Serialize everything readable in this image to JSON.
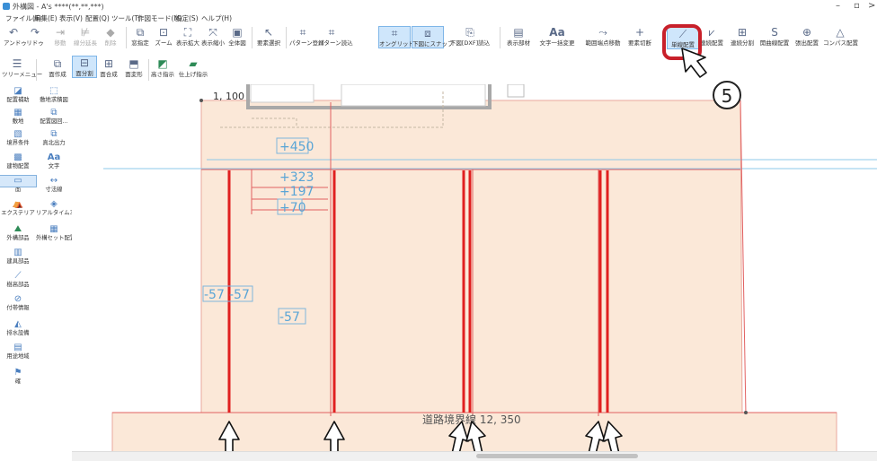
{
  "window": {
    "title": "外構図 - A's ****(**,**,***)",
    "minimize": "–",
    "restore": "▫",
    "more": ">"
  },
  "menu": [
    "ファイル(F)",
    "編集(E)",
    "表示(V)",
    "配置(Q)",
    "ツール(T)",
    "作図モード(M)",
    "設定(S)",
    "ヘルプ(H)"
  ],
  "toolbar_row1": [
    {
      "label": "アンドゥ",
      "icon": "undo-icon"
    },
    {
      "label": "リドゥ",
      "icon": "redo-icon"
    },
    {
      "label": "移動",
      "icon": "move-icon",
      "dim": true
    },
    {
      "label": "線分延長",
      "icon": "extend-icon",
      "dim": true
    },
    {
      "label": "削除",
      "icon": "delete-icon",
      "dim": true
    },
    {
      "label": "窓指定",
      "icon": "window-select-icon"
    },
    {
      "label": "ズーム",
      "icon": "zoom-icon"
    },
    {
      "label": "表示拡大",
      "icon": "zoom-in-icon"
    },
    {
      "label": "表示縮小",
      "icon": "zoom-out-icon"
    },
    {
      "label": "全体図",
      "icon": "fit-all-icon"
    },
    {
      "label": "要素選択",
      "icon": "select-arrow-icon"
    },
    {
      "label": "パターン登録",
      "icon": "pattern-register-icon"
    },
    {
      "label": "パターン読込",
      "icon": "pattern-load-icon"
    },
    {
      "label": "オングリッド",
      "icon": "on-grid-icon",
      "active": true
    },
    {
      "label": "下図にスナップ",
      "icon": "snap-underlay-icon",
      "active": true
    },
    {
      "label": "下図[DXF]読込",
      "icon": "dxf-import-icon"
    },
    {
      "label": "表示部材",
      "icon": "display-parts-icon"
    },
    {
      "label": "文字一括変更",
      "icon": "text-change-icon"
    },
    {
      "label": "範囲端点移動",
      "icon": "range-move-icon"
    },
    {
      "label": "要素切断",
      "icon": "cut-element-icon"
    },
    {
      "label": "単線配置",
      "icon": "single-line-icon",
      "active": true
    },
    {
      "label": "連続配置",
      "icon": "continuous-line-icon"
    },
    {
      "label": "連続分割",
      "icon": "continuous-split-icon"
    },
    {
      "label": "開曲線配置",
      "icon": "open-curve-icon"
    },
    {
      "label": "張出配置",
      "icon": "overhang-icon"
    },
    {
      "label": "コンパス配置",
      "icon": "compass-icon"
    }
  ],
  "toolbar_row2": [
    {
      "label": "ツリーメニュー",
      "icon": "tree-menu-icon"
    },
    {
      "label": "面作成",
      "icon": "create-face-icon"
    },
    {
      "label": "面分割",
      "icon": "split-face-icon",
      "active": true
    },
    {
      "label": "面合成",
      "icon": "merge-face-icon"
    },
    {
      "label": "面変形",
      "icon": "deform-face-icon"
    },
    {
      "label": "高さ指示",
      "icon": "height-icon"
    },
    {
      "label": "仕上げ指示",
      "icon": "finish-icon"
    }
  ],
  "sidebar": [
    {
      "label": "配置補助",
      "icon": "placement-aid-icon"
    },
    {
      "label": "敷地求積図",
      "icon": "site-area-icon"
    },
    {
      "label": "敷地",
      "icon": "site-icon"
    },
    {
      "label": "配置図回...",
      "icon": "layout-rotate-icon"
    },
    {
      "label": "境界条件",
      "icon": "boundary-icon"
    },
    {
      "label": "真北出力",
      "icon": "true-north-icon"
    },
    {
      "label": "建物配置",
      "icon": "building-icon"
    },
    {
      "label": "文字",
      "icon": "text-icon"
    },
    {
      "label": "面",
      "icon": "face-icon",
      "active": true
    },
    {
      "label": "寸法線",
      "icon": "dimension-icon"
    },
    {
      "label": "エクステリア",
      "icon": "exterior-icon"
    },
    {
      "label": "リアルタイム3D...",
      "icon": "realtime-3d-icon"
    },
    {
      "label": "外構部品",
      "icon": "exterior-parts-icon"
    },
    {
      "label": "外構セット配置",
      "icon": "exterior-set-icon"
    },
    {
      "label": "建具部品",
      "icon": "fitting-parts-icon"
    },
    {
      "label": "樹高部品",
      "icon": "tree-parts-icon"
    },
    {
      "label": "付帯情報",
      "icon": "attached-info-icon"
    },
    {
      "label": "排水設備",
      "icon": "drainage-icon"
    },
    {
      "label": "用途地域",
      "icon": "zoning-icon"
    },
    {
      "label": "確",
      "icon": "confirm-icon"
    }
  ],
  "drawing": {
    "dimension_top": "1, 100",
    "height_labels": [
      "+450",
      "+323",
      "+197",
      "+70",
      "-57",
      "-57",
      "-57"
    ],
    "road_label": "道路境界線  12, 350",
    "colors": {
      "fill": "#fbe8d8",
      "red": "#e02020",
      "outline": "#e9a79c",
      "blue_line": "#8ec9e8"
    }
  },
  "annotation": {
    "step_number": "5"
  }
}
